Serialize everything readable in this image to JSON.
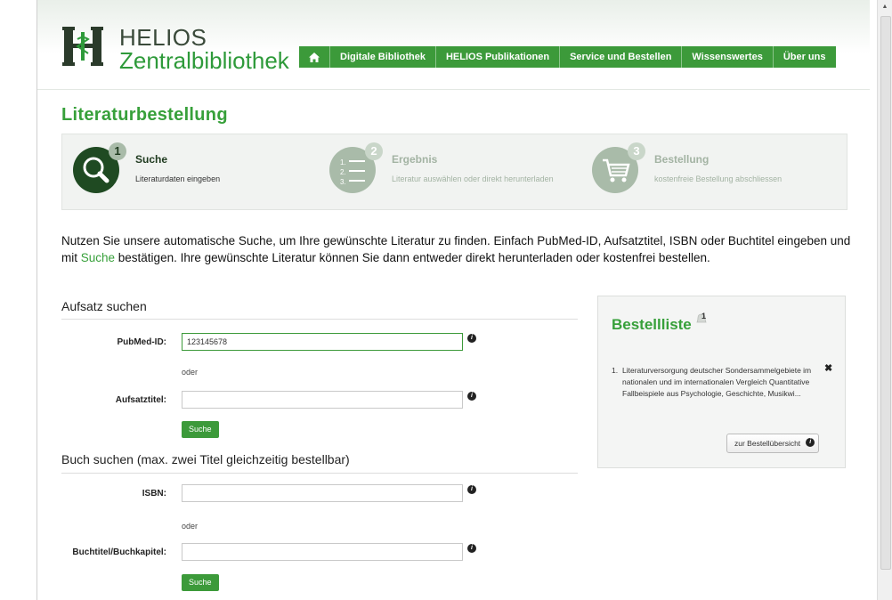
{
  "brand": {
    "name_line1": "HELIOS",
    "name_line2": "Zentralbibliothek",
    "logo_letters": "H"
  },
  "nav": {
    "home_icon": "home-icon",
    "items": [
      {
        "label": "Digitale Bibliothek"
      },
      {
        "label": "HELIOS Publikationen"
      },
      {
        "label": "Service und Bestellen"
      },
      {
        "label": "Wissenswertes"
      },
      {
        "label": "Über uns"
      }
    ]
  },
  "page_title": "Literaturbestellung",
  "steps": [
    {
      "number": "1",
      "title": "Suche",
      "subtitle": "Literaturdaten eingeben",
      "icon": "magnifier-icon",
      "active": true
    },
    {
      "number": "2",
      "title": "Ergebnis",
      "subtitle": "Literatur auswählen oder direkt herunterladen",
      "icon": "numbered-list-icon",
      "active": false
    },
    {
      "number": "3",
      "title": "Bestellung",
      "subtitle": "kostenfreie Bestellung abschliessen",
      "icon": "shopping-cart-icon",
      "active": false
    }
  ],
  "intro": {
    "part1": "Nutzen Sie unsere automatische Suche, um Ihre gewünschte Literatur zu finden. Einfach PubMed-ID, Aufsatztitel, ISBN oder Buchtitel eingeben und mit ",
    "link": "Suche",
    "part2": " bestätigen. Ihre gewünschte Literatur können Sie dann entweder direkt herunterladen oder kostenfrei bestellen."
  },
  "article_search": {
    "heading": "Aufsatz suchen",
    "pubmed_label": "PubMed-ID:",
    "pubmed_value": "123145678",
    "or_text": "oder",
    "title_label": "Aufsatztitel:",
    "title_value": "",
    "search_button": "Suche"
  },
  "book_search": {
    "heading": "Buch suchen (max. zwei Titel gleichzeitig bestellbar)",
    "isbn_label": "ISBN:",
    "isbn_value": "",
    "or_text": "oder",
    "title_label": "Buchtitel/Buchkapitel:",
    "title_value": "",
    "search_button": "Suche"
  },
  "order_list": {
    "title": "Bestellliste",
    "badge": "1",
    "items": [
      {
        "index": "1.",
        "text": "Literaturversorgung deutscher Sondersammelgebiete im nationalen und im internationalen Vergleich Quantitative Fallbeispiele aus Psychologie, Geschichte, Musikwi..."
      }
    ],
    "remove_glyph": "✖",
    "overview_button": "zur Bestellübersicht"
  },
  "colors": {
    "brand_green": "#3c9a3a",
    "title_green": "#37a03a",
    "step_active": "#1f4a22",
    "step_inactive": "#a9bba9"
  }
}
